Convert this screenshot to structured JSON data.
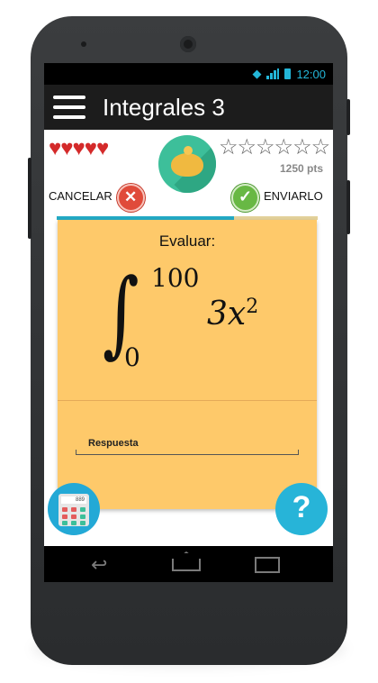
{
  "status_bar": {
    "time": "12:00",
    "icons": [
      "wifi-icon",
      "signal-icon",
      "battery-icon"
    ]
  },
  "app_bar": {
    "title": "Integrales 3",
    "menu_icon": "hamburger-icon"
  },
  "lives": {
    "hearts": 5,
    "icon": "heart-icon",
    "color": "#d42a2a"
  },
  "rating": {
    "stars_filled": 0,
    "stars_total": 6,
    "points_label": "1250 pts"
  },
  "piggy_bank": {
    "icon": "piggy-bank-icon",
    "color": "#3dbf9a"
  },
  "actions": {
    "cancel_label": "CANCELAR",
    "send_label": "ENVIARLO"
  },
  "progress": {
    "fraction": 0.68,
    "color": "#23a9c4"
  },
  "question": {
    "prompt": "Evaluar:",
    "integral_lower": "0",
    "integral_upper": "100",
    "integrand_base": "3x",
    "integrand_exp": "2"
  },
  "answer": {
    "placeholder": "Respuesta",
    "value": ""
  },
  "floating_buttons": {
    "calculator_icon": "calculator-icon",
    "calculator_display": "889",
    "help_icon": "question-mark-icon",
    "help_label": "?"
  },
  "colors": {
    "card": "#fec96a",
    "appbar": "#1c1c1c",
    "accent": "#23a9d6"
  }
}
